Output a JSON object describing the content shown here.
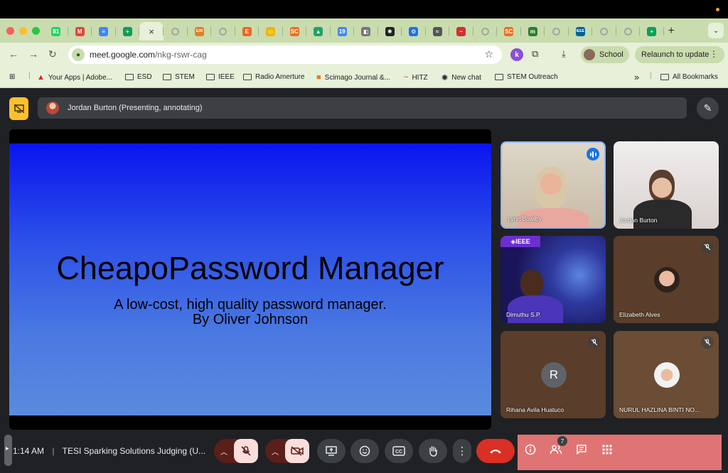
{
  "browser": {
    "url_host": "meet.google.com",
    "url_path": "/nkg-rswr-cag",
    "profile_label": "School",
    "relaunch_label": "Relaunch to update",
    "active_tab_close": "×",
    "extension_k": "k"
  },
  "tabs": [
    {
      "icon": "whatsapp-icon",
      "color": "#25d366",
      "glyph": "81"
    },
    {
      "icon": "gmail-icon",
      "color": "#ea4335",
      "glyph": "M"
    },
    {
      "icon": "docs-icon",
      "color": "#4285f4",
      "glyph": "≡"
    },
    {
      "icon": "sheets-icon",
      "color": "#0f9d58",
      "glyph": "+"
    },
    {
      "icon": "globe-icon",
      "color": "#a0a8a0",
      "glyph": ""
    },
    {
      "icon": "sjr-icon",
      "color": "#e67e22",
      "glyph": "SJR"
    },
    {
      "icon": "globe-icon",
      "color": "#a0a8a0",
      "glyph": ""
    },
    {
      "icon": "etsy-icon",
      "color": "#f1641e",
      "glyph": "E"
    },
    {
      "icon": "slides-icon",
      "color": "#f4b400",
      "glyph": "▭"
    },
    {
      "icon": "sc-icon",
      "color": "#e8711c",
      "glyph": "SC"
    },
    {
      "icon": "drive-icon",
      "color": "#1fa463",
      "glyph": "▲"
    },
    {
      "icon": "calendar-icon",
      "color": "#4285f4",
      "glyph": "19"
    },
    {
      "icon": "contacts-icon",
      "color": "#777777",
      "glyph": "◧"
    },
    {
      "icon": "chatgpt-icon",
      "color": "#222222",
      "glyph": "✺"
    },
    {
      "icon": "gear-icon",
      "color": "#1a73e8",
      "glyph": "⚙"
    },
    {
      "icon": "radio-icon",
      "color": "#555555",
      "glyph": "≈"
    },
    {
      "icon": "hitz-icon",
      "color": "#d32f2f",
      "glyph": "~"
    },
    {
      "icon": "globe-icon",
      "color": "#a0a8a0",
      "glyph": ""
    },
    {
      "icon": "sc-icon",
      "color": "#e8711c",
      "glyph": "SC"
    },
    {
      "icon": "m-icon",
      "color": "#2e7d32",
      "glyph": "m"
    },
    {
      "icon": "globe-icon",
      "color": "#a0a8a0",
      "glyph": ""
    },
    {
      "icon": "ieee-icon",
      "color": "#00629b",
      "glyph": "IEEE"
    },
    {
      "icon": "globe-icon",
      "color": "#a0a8a0",
      "glyph": ""
    },
    {
      "icon": "globe-icon",
      "color": "#a0a8a0",
      "glyph": ""
    },
    {
      "icon": "sheets-icon",
      "color": "#0f9d58",
      "glyph": "+"
    }
  ],
  "bookmarks": [
    {
      "label": "Your Apps | Adobe...",
      "icon": "adobe-icon"
    },
    {
      "label": "ESD",
      "icon": "folder-icon"
    },
    {
      "label": "STEM",
      "icon": "folder-icon"
    },
    {
      "label": "IEEE",
      "icon": "folder-icon"
    },
    {
      "label": "Radio Amerture",
      "icon": "folder-icon"
    },
    {
      "label": "Scimago Journal &...",
      "icon": "sjr-icon"
    },
    {
      "label": "HITZ",
      "icon": "hitz-icon"
    },
    {
      "label": "New chat",
      "icon": "chatgpt-icon"
    },
    {
      "label": "STEM Outreach",
      "icon": "folder-icon"
    }
  ],
  "bookmarks_overflow": "»",
  "all_bookmarks": "All Bookmarks",
  "meet": {
    "presenter_banner": "Jordan Burton (Presenting, annotating)",
    "slide_title": "CheapoPassword Manager",
    "slide_subtitle_1": "A low-cost, high quality password manager.",
    "slide_subtitle_2": "By Oliver Johnson",
    "time": "1:14 AM",
    "separator": "|",
    "meeting_title": "TESI Sparking Solutions Judging (U...",
    "participant_count": "7",
    "ieee_overlay": "◈IEEE"
  },
  "participants": [
    {
      "name": "Lynn Bowlby",
      "state": "speaking"
    },
    {
      "name": "Jordan Burton",
      "state": "unmuted"
    },
    {
      "name": "Dimuthu S.P.",
      "state": "unmuted"
    },
    {
      "name": "Elizabeth Alves",
      "state": "muted"
    },
    {
      "name": "Rihana Avila Huatuco",
      "state": "muted",
      "initial": "R"
    },
    {
      "name": "NURUL HAZLINA BINTI NO...",
      "state": "muted"
    }
  ]
}
